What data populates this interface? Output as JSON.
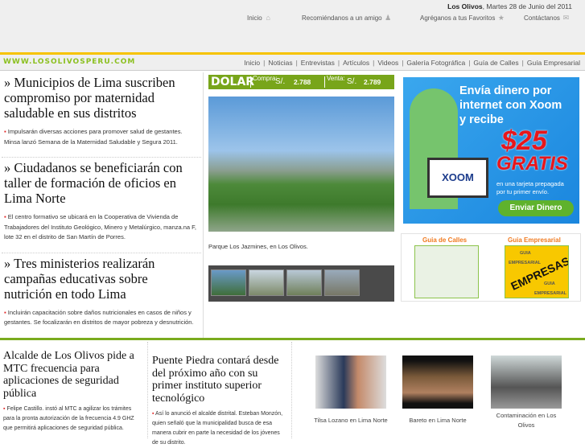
{
  "header": {
    "location": "Los Olivos",
    "date": ", Martes 28 de Junio del 2011",
    "links": [
      {
        "label": "Inicio",
        "icon": "home-icon"
      },
      {
        "label": "Recomiéndanos a un amigo",
        "icon": "person-icon"
      },
      {
        "label": "Agréganos a tus Favoritos",
        "icon": "star-icon"
      },
      {
        "label": "Contáctanos",
        "icon": "mail-icon"
      }
    ]
  },
  "nav": {
    "logo": "WWW.LOSOLIVOSPERU.COM",
    "items": [
      "Inicio",
      "Noticias",
      "Entrevistas",
      "Artículos",
      "Videos",
      "Galería Fotográfica",
      "Guía de Calles",
      "Guía Empresarial"
    ]
  },
  "articles": [
    {
      "title": "» Municipios de Lima suscriben compromiso por maternidad saludable en sus distritos",
      "summary": "Impulsarán diversas acciones para promover salud de gestantes. Minsa lanzó Semana de la Maternidad Saludable y Segura 2011."
    },
    {
      "title": "» Ciudadanos se beneficiarán con taller de formación de oficios en Lima Norte",
      "summary": "El centro formativo se ubicará en la Cooperativa de Vivienda de Trabajadores del Instituto Geológico, Minero y Metalúrgico, manza.na F, lote 32 en el distrito de San Martín de Porres."
    },
    {
      "title": "» Tres ministerios realizarán campañas educativas sobre nutrición en todo Lima",
      "summary": "Incluirán capacitación sobre daños nutricionales en casos de niños y gestantes. Se focalizarán en distritos de mayor pobreza y desnutrición."
    }
  ],
  "dolar": {
    "label": "DOLAR",
    "compra_label": "Compra:",
    "venta_label": "Venta:",
    "currency": "S/.",
    "compra": "2.788",
    "venta": "2.789"
  },
  "photo": {
    "caption": "Parque Los Jazmines, en Los Olivos."
  },
  "ad": {
    "line1": "Envía dinero por",
    "line2": "internet con Xoom",
    "line3": "y recibe",
    "amount": "$25",
    "gratis": "GRATIS",
    "sub1": "en una tarjeta prepagada",
    "sub2": "por tu primer envío.",
    "button": "Enviar Dinero",
    "brand": "XOOM"
  },
  "guides": {
    "calles": "Guia de Calles",
    "empresarial": "Guia Empresarial",
    "emp_img": {
      "guia": "GUIA",
      "empresarial": "EMPRESARIAL",
      "empresas": "EMPRESAS"
    }
  },
  "bottom": [
    {
      "title": "Alcalde de Los Olivos pide a MTC frecuencia para aplicaciones de seguridad pública",
      "summary": "Felipe Castillo. instó al MTC a agilizar los trámites para la pronta autorización de la frecuencia 4.9 GHZ que permitirá aplicaciones de seguridad pública."
    },
    {
      "title": "Puente Piedra contará desde del próximo año con su primer instituto superior tecnológico",
      "summary": "Así lo anunció el alcalde distrital. Esteban Monzón, quien señaló que la municipalidad busca de esa manera cubrir en parte la necesidad de los jóvenes de su distrito."
    }
  ],
  "videos": [
    "Tilsa Lozano en Lima Norte",
    "Bareto en Lima Norte",
    "Contaminación en Los Olivos"
  ]
}
